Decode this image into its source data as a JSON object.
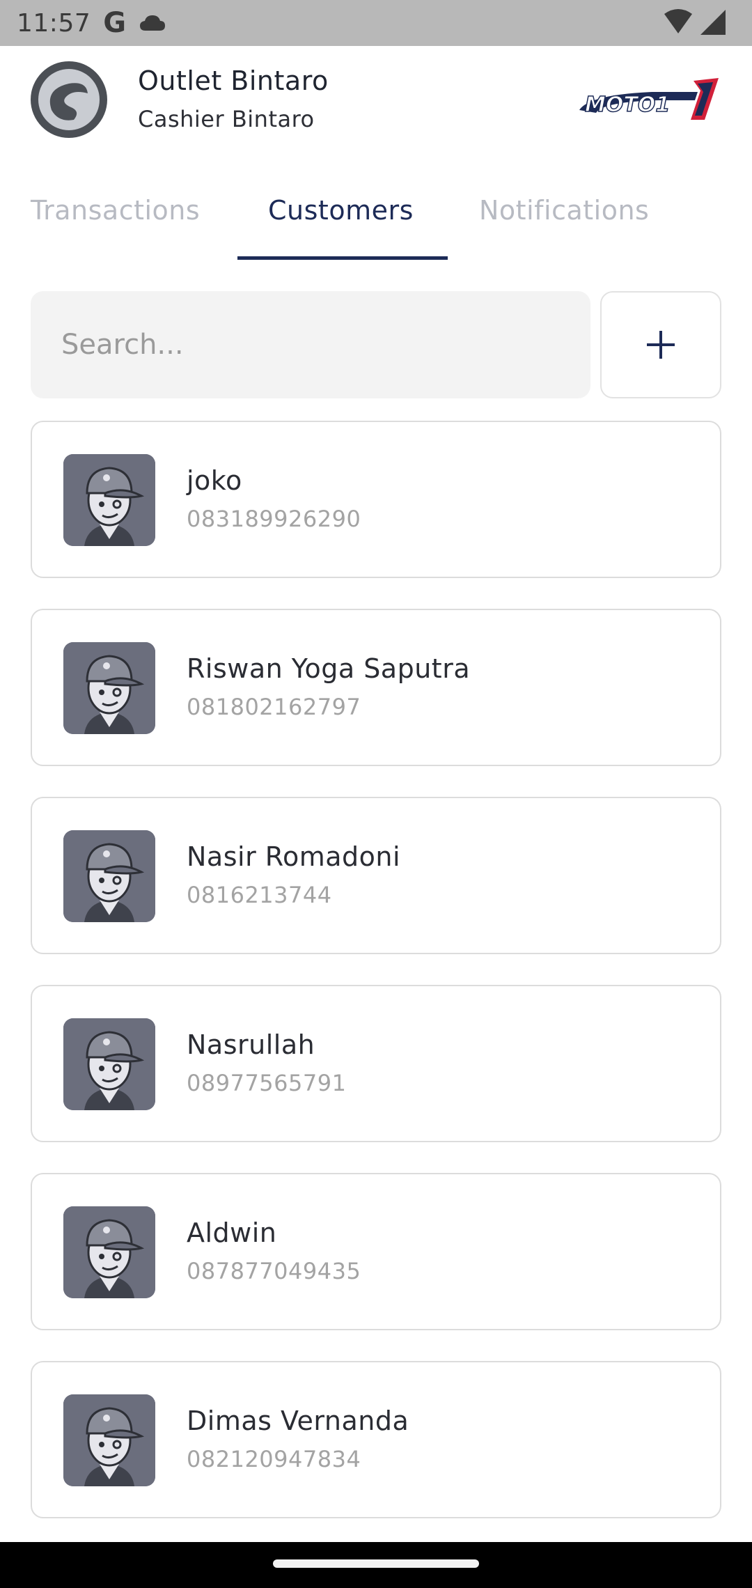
{
  "status_bar": {
    "time": "11:57",
    "g_label": "G"
  },
  "header": {
    "outlet_name": "Outlet Bintaro",
    "role": "Cashier Bintaro",
    "brand": "MOTO1"
  },
  "tabs": [
    {
      "label": "Transactions",
      "active": false
    },
    {
      "label": "Customers",
      "active": true
    },
    {
      "label": "Notifications",
      "active": false
    }
  ],
  "search": {
    "placeholder": "Search..."
  },
  "add_button": {
    "icon": "plus-icon"
  },
  "customers": [
    {
      "name": "joko",
      "phone": "083189926290"
    },
    {
      "name": "Riswan Yoga Saputra",
      "phone": "081802162797"
    },
    {
      "name": "Nasir Romadoni",
      "phone": "0816213744"
    },
    {
      "name": "Nasrullah",
      "phone": "08977565791"
    },
    {
      "name": "Aldwin",
      "phone": "087877049435"
    },
    {
      "name": "Dimas Vernanda",
      "phone": "082120947834"
    }
  ],
  "colors": {
    "primary": "#1d2b57",
    "tab_inactive": "#b7bac2",
    "avatar_bg": "#6b6e7d"
  }
}
